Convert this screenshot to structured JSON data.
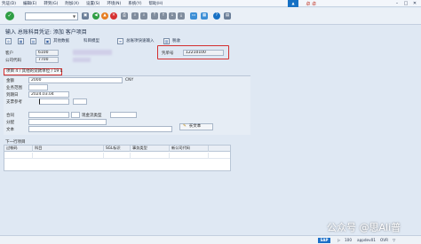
{
  "menubar": {
    "items": [
      "凭证(D)",
      "编辑(E)",
      "转到(G)",
      "附加(X)",
      "设置(S)",
      "环境(N)",
      "系统(Y)",
      "帮助(H)"
    ],
    "logo_text": "卓 卓"
  },
  "title": "输入 总账科目凭证: 添加 客户项目",
  "apptoolbar": {
    "items": [
      "其他数据",
      "科目模型",
      "总账项快速输入",
      "税收"
    ]
  },
  "header": {
    "client_label": "客户",
    "client_value": "6100",
    "company_label": "公司代码",
    "company_value": "7700",
    "doc_label": "凭单号",
    "doc_value": "12210100"
  },
  "tab": {
    "label": "项目 4 / 其他的贷款单位 / 19 L"
  },
  "item": {
    "amount_label": "金额",
    "amount_value": "2000",
    "currency": "CNY",
    "business_area_label": "业务范围",
    "baseline_date_label": "到期日",
    "baseline_date_value": "2024.03.04",
    "payment_ref_label": "支票参考",
    "contract_label": "合同",
    "flow_type_label": "现金流类型",
    "assignment_label": "分配",
    "text_label": "文本",
    "long_text_button": "长文本"
  },
  "next_item": {
    "label": "下一行项目",
    "columns": [
      "过帐码",
      "科目",
      "SGL标识",
      "事务类型",
      "新公司代码"
    ]
  },
  "statusbar": {
    "sap": "SAP",
    "items": [
      "▷",
      "100",
      "appdev01",
      "OVR",
      "▽"
    ]
  },
  "watermark": "公众号 @思Ali普"
}
